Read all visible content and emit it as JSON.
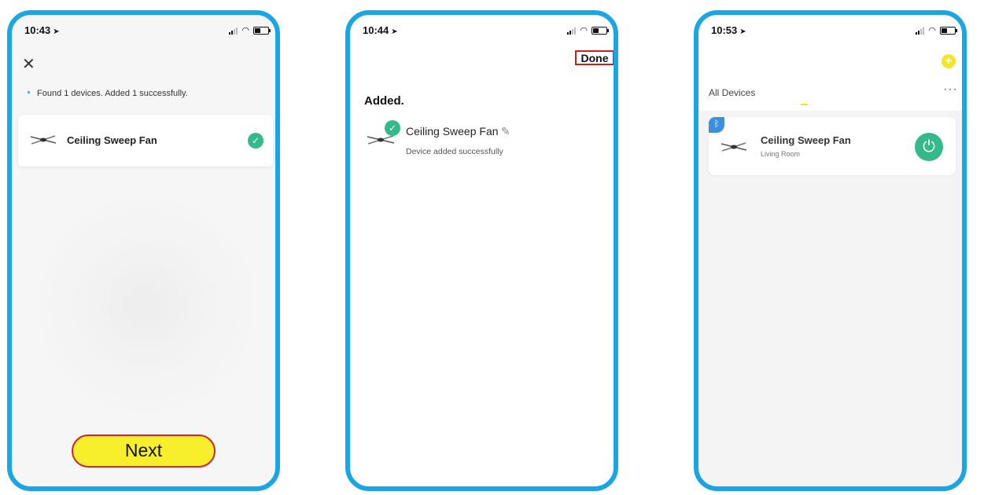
{
  "screens": [
    {
      "time": "10:43",
      "close_icon": "close-icon",
      "found_text": "Found 1 devices. Added 1 successfully.",
      "device_name": "Ceiling Sweep Fan",
      "next_label": "Next"
    },
    {
      "time": "10:44",
      "done_label": "Done",
      "added_heading": "Added.",
      "device_name": "Ceiling Sweep Fan",
      "device_status": "Device added successfully"
    },
    {
      "time": "10:53",
      "add_icon": "+",
      "tab_label": "All Devices",
      "more_label": "···",
      "device_name": "Ceiling Sweep Fan",
      "room": "Living Room"
    }
  ],
  "colors": {
    "phone_border": "#1aa6e4",
    "accent_green": "#34b98a",
    "button_yellow": "#f7ee2c",
    "highlight_red": "#d22424"
  }
}
